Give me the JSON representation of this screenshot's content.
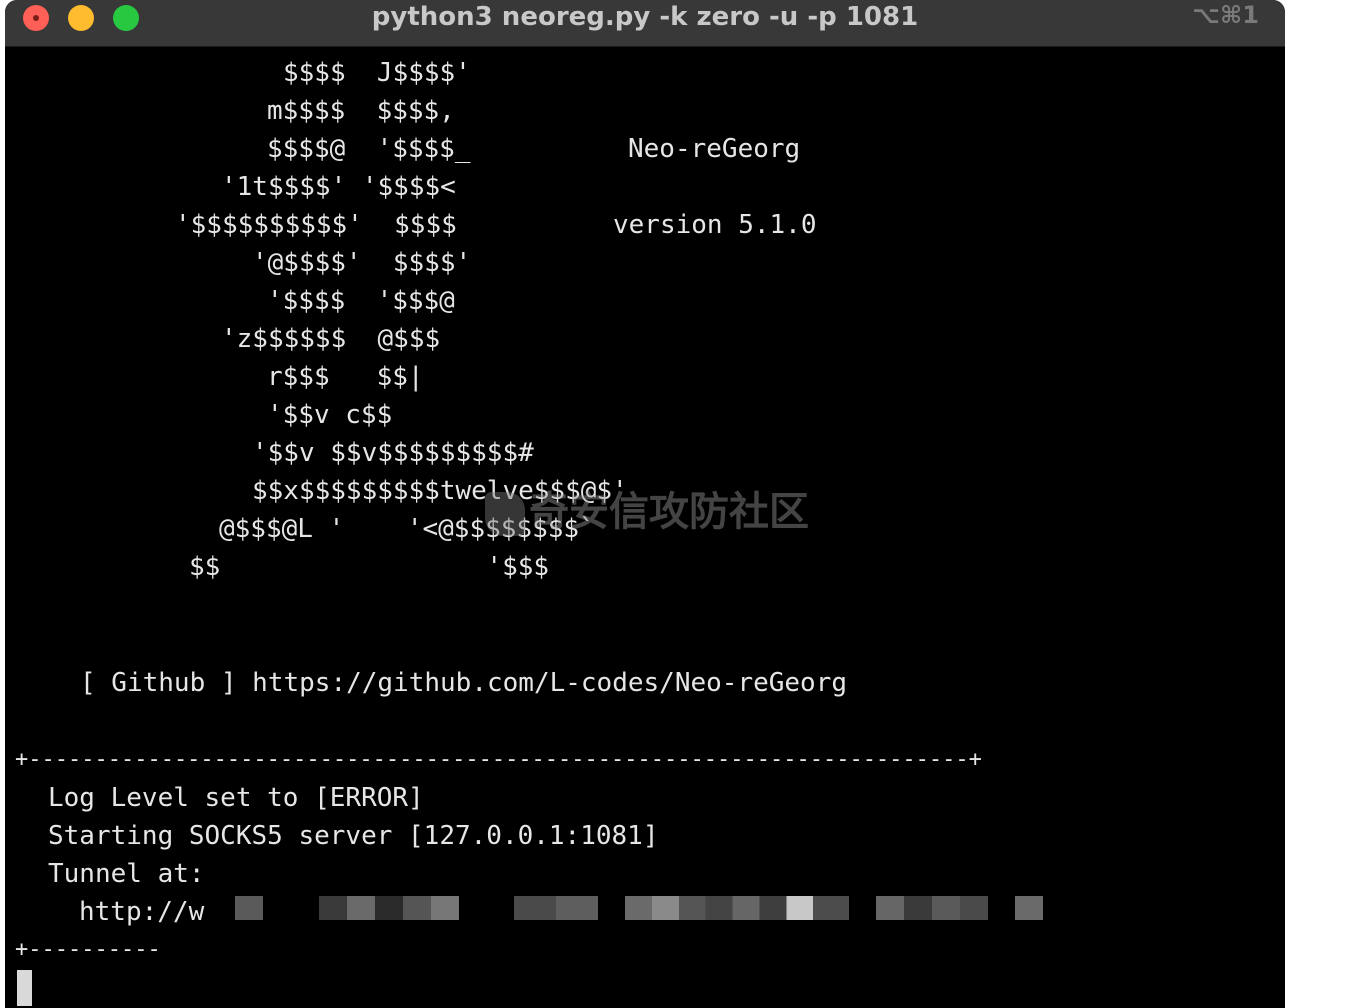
{
  "window": {
    "title": "python3 neoreg.py -k zero -u  -p 1081",
    "shortcut": "⌥⌘1"
  },
  "banner": {
    "art": [
      "$$$$  J$$$$'",
      "m$$$$  $$$$,",
      "$$$$@  '$$$$_",
      "'1t$$$$' '$$$$<",
      "'$$$$$$$$$$'  $$$$",
      "'@$$$$'  $$$$'",
      "'$$$$  '$$$@",
      "'z$$$$$$  @$$$",
      "r$$$   $$|",
      "'$$v c$$",
      "'$$v $$v$$$$$$$$$#",
      "$$x$$$$$$$$$twelve$$$@$'",
      "@$$$@L '    '<@$$$$$$$$`",
      "$$                 '$$$"
    ],
    "name": "Neo-reGeorg",
    "version": "version 5.1.0",
    "github": "[ Github ] https://github.com/L-codes/Neo-reGeorg"
  },
  "box": {
    "top_border": "+-----------------------------------------------------------------------+",
    "log_level": "Log Level set to [ERROR]",
    "socks": "Starting SOCKS5 server [127.0.0.1:1081]",
    "tunnel_label": "Tunnel at:",
    "tunnel_url": "http://w",
    "bottom_border": "+----------"
  },
  "watermark": "奇安信攻防社区",
  "colors": {
    "terminal_bg": "#000000",
    "terminal_text": "#e6e6e6",
    "titlebar_bg": "#383838",
    "close": "#fe5f57",
    "minimize": "#febc2e",
    "maximize": "#28c840"
  }
}
